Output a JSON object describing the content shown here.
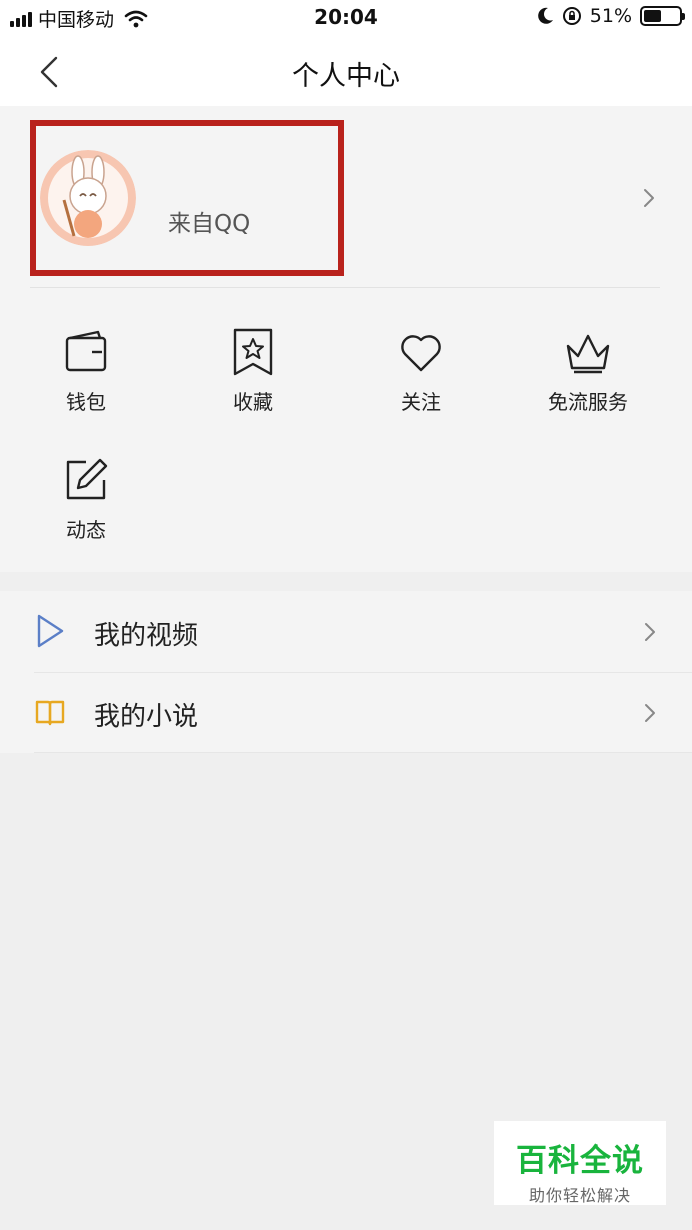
{
  "status_bar": {
    "carrier": "中国移动",
    "time": "20:04",
    "battery": "51%",
    "battery_level": 0.51
  },
  "nav": {
    "title": "个人中心"
  },
  "profile": {
    "name": "来自QQ"
  },
  "quick_actions": [
    {
      "label": "钱包",
      "icon": "wallet-icon"
    },
    {
      "label": "收藏",
      "icon": "bookmark-star-icon"
    },
    {
      "label": "关注",
      "icon": "heart-icon"
    },
    {
      "label": "免流服务",
      "icon": "crown-icon"
    },
    {
      "label": "动态",
      "icon": "edit-icon"
    }
  ],
  "menu": [
    {
      "label": "我的视频",
      "icon": "play-icon",
      "color": "#5b7fc7"
    },
    {
      "label": "我的小说",
      "icon": "book-icon",
      "color": "#e7a821"
    }
  ],
  "watermark": {
    "title": "百科全说",
    "subtitle": "助你轻松解决"
  },
  "colors": {
    "highlight": "#b9221c",
    "watermark_green": "#19b43d"
  }
}
